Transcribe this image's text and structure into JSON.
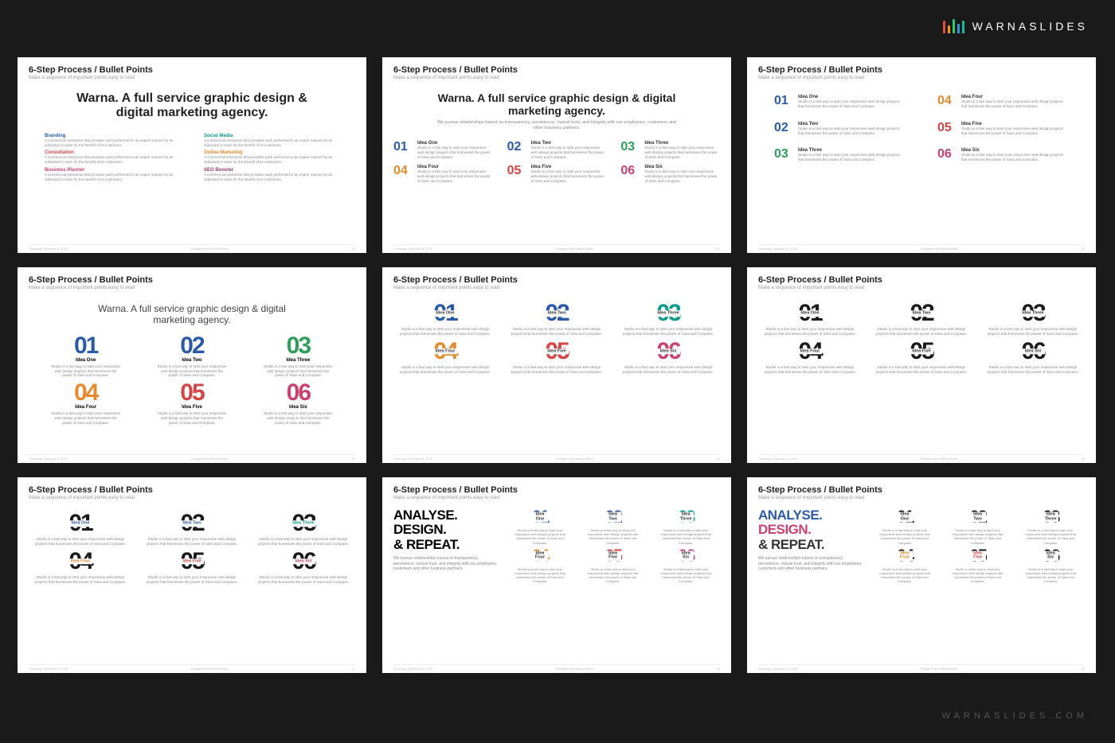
{
  "brand": "WARNASLIDES",
  "watermark": "WARNASLIDES.COM",
  "slide_title": "6-Step Process / Bullet Points",
  "slide_subtitle": "Make a sequence of important points easy to read",
  "footer_date": "Thursday, February 6, 2020",
  "footer_credit": "Designed by Warna Slides",
  "hero": "Warna. A full service graphic design & digital marketing agency.",
  "hero_sub": "We pursue relationships based on transparency, persistence, mutual trust, and integrity with our employees, customers and other business partners.",
  "service_desc": "A commercial enterprise that provides work performed in an expert manner by an individual or team for the benefit of its customers.",
  "services": [
    {
      "t": "Branding"
    },
    {
      "t": "Social Media"
    },
    {
      "t": "Consultation"
    },
    {
      "t": "Online Marketing"
    },
    {
      "t": "Business Planner"
    },
    {
      "t": "SEO Booster"
    }
  ],
  "idea_desc": "Studio is a fast way to start your responsive web design projects that harnesses the power of Sass and Compass.",
  "ideas": [
    "Idea One",
    "Idea Two",
    "Idea Three",
    "Idea Four",
    "Idea Five",
    "Idea Six"
  ],
  "nums": [
    "01",
    "02",
    "03",
    "04",
    "05",
    "06"
  ],
  "adr": {
    "l1": "ANALYSE.",
    "l2": "DESIGN.",
    "l3": "& REPEAT."
  },
  "adr_sub": "We pursue relationships based on transparency, persistence, mutual trust, and integrity with our employees, customers and other business partners.",
  "page_nums": [
    "11",
    "12",
    "13",
    "14",
    "15",
    "16",
    "17",
    "18",
    "19"
  ]
}
